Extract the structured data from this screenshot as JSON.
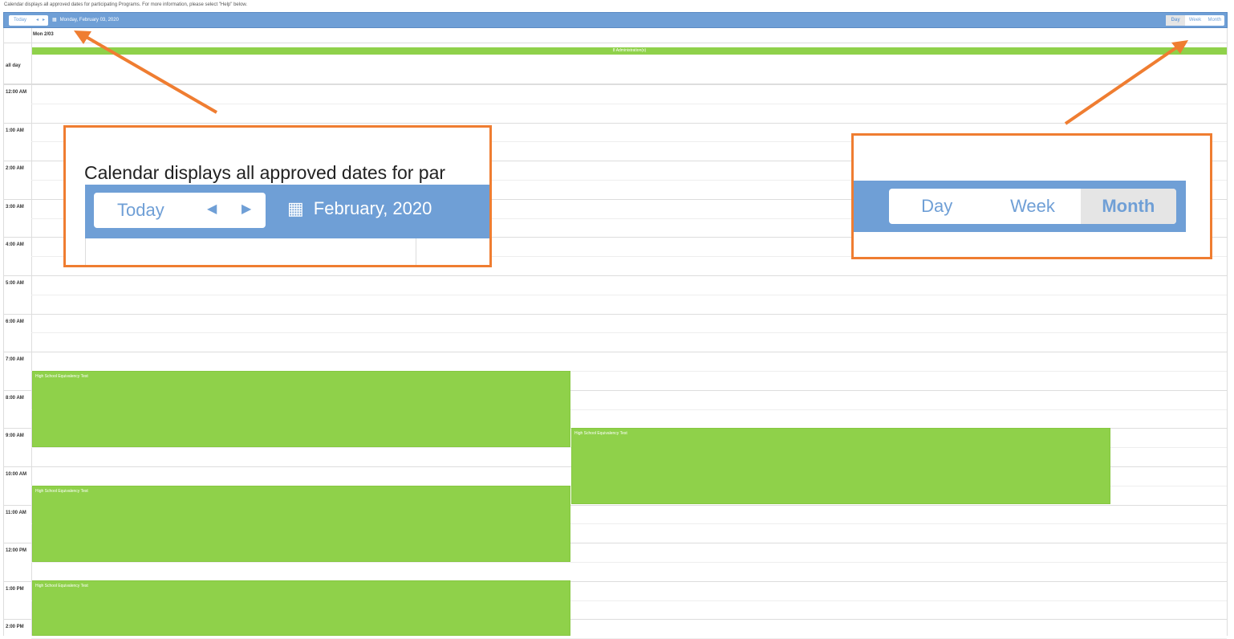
{
  "info_text": "Calendar displays all approved dates for participating Programs. For more information, please select \"Help\" below.",
  "toolbar": {
    "today_label": "Today",
    "prev_icon": "caret-left-icon",
    "next_icon": "caret-right-icon",
    "calendar_icon": "calendar-icon",
    "date_label": "Monday, February 03, 2020",
    "views": [
      "Day",
      "Week",
      "Month"
    ],
    "active_view": "Day"
  },
  "column_header": "Mon 2/03",
  "all_day": {
    "label": "all day",
    "event_label": "8 Administration(s)"
  },
  "time_labels": [
    "12:00 AM",
    "1:00 AM",
    "2:00 AM",
    "3:00 AM",
    "4:00 AM",
    "5:00 AM",
    "6:00 AM",
    "7:00 AM",
    "8:00 AM",
    "9:00 AM",
    "10:00 AM",
    "11:00 AM",
    "12:00 PM",
    "1:00 PM",
    "2:00 PM"
  ],
  "events": [
    {
      "title": "High School Equivalency Test"
    },
    {
      "title": "High School Equivalency Test"
    },
    {
      "title": "High School Equivalency Test"
    },
    {
      "title": "High School Equivalency Test"
    }
  ],
  "zoom_left": {
    "info_text": "Calendar displays all approved dates for par",
    "today_label": "Today",
    "date_label": "February, 2020"
  },
  "zoom_right": {
    "views": [
      "Day",
      "Week",
      "Month"
    ],
    "active_view": "Month"
  },
  "colors": {
    "toolbar": "#6f9fd6",
    "event": "#8fd14a",
    "callout": "#ef7d31"
  }
}
